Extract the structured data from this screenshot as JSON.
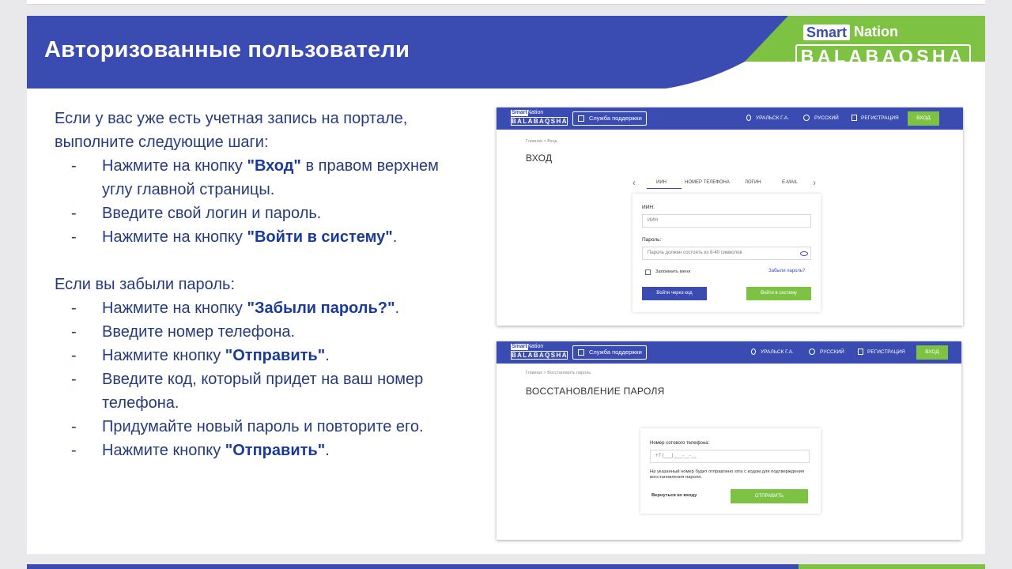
{
  "slide": {
    "title": "Авторизованные пользователи",
    "brand": {
      "smart": "Smart",
      "nation": "Nation",
      "name": "BALABAQSHA"
    },
    "colors": {
      "banner_blue": "#3a4cb2",
      "brand_green": "#7dc243",
      "text_navy": "#263b7b"
    }
  },
  "section1": {
    "intro": "Если у вас уже есть учетная запись на портале, выполните следующие шаги:",
    "steps": [
      {
        "pre": "Нажмите на кнопку ",
        "bold": "\"Вход\"",
        "post": " в правом верхнем углу главной страницы."
      },
      {
        "pre": "Введите свой логин и пароль.",
        "bold": "",
        "post": ""
      },
      {
        "pre": "Нажмите на кнопку ",
        "bold": "\"Войти в систему\"",
        "post": "."
      }
    ]
  },
  "section2": {
    "intro": "Если вы забыли пароль:",
    "steps": [
      {
        "pre": "Нажмите на кнопку ",
        "bold": "\"Забыли пароль?\"",
        "post": "."
      },
      {
        "pre": "Введите номер телефона.",
        "bold": "",
        "post": ""
      },
      {
        "pre": "Нажмите кнопку ",
        "bold": "\"Отправить\"",
        "post": "."
      },
      {
        "pre": "Введите код, который придет на ваш номер телефона.",
        "bold": "",
        "post": ""
      },
      {
        "pre": "Придумайте новый пароль и повторите его.",
        "bold": "",
        "post": ""
      },
      {
        "pre": "Нажмите кнопку ",
        "bold": "\"Отправить\"",
        "post": "."
      }
    ]
  },
  "dash": "-",
  "nav": {
    "logo_smart": "Smart",
    "logo_nation": "Nation",
    "logo_name": "BALABAQSHA",
    "support": "Служба поддержки",
    "city": "УРАЛЬСК Г.А.",
    "language": "РУССКИЙ",
    "register": "РЕГИСТРАЦИЯ",
    "login": "ВХОД"
  },
  "login_page": {
    "breadcrumb": "Главная   >   Вход",
    "heading": "ВХОД",
    "tabs": [
      "ИИН",
      "НОМЕР ТЕЛЕФОНА",
      "ЛОГИН",
      "E-MAIL"
    ],
    "iin_label": "ИИН:",
    "iin_placeholder": "ИИН",
    "password_label": "Пароль:",
    "password_placeholder": "Пароль должен состоять из 8-40 символов",
    "remember": "Запомнить меня",
    "forgot": "Забыли пароль?",
    "code_button": "Войти через код",
    "submit_button": "Войти в систему"
  },
  "recovery_page": {
    "breadcrumb": "Главная   >   Восстановить пароль",
    "heading": "ВОССТАНОВЛЕНИЕ ПАРОЛЯ",
    "phone_label": "Номер сотового телефона:",
    "phone_placeholder": "+7 (___) ___-__-__",
    "note": "На указанный номер будет отправлено sms с кодом для подтверждения восстановления пароля.",
    "back": "Вернуться ко входу",
    "send_button": "ОТПРАВИТЬ"
  }
}
